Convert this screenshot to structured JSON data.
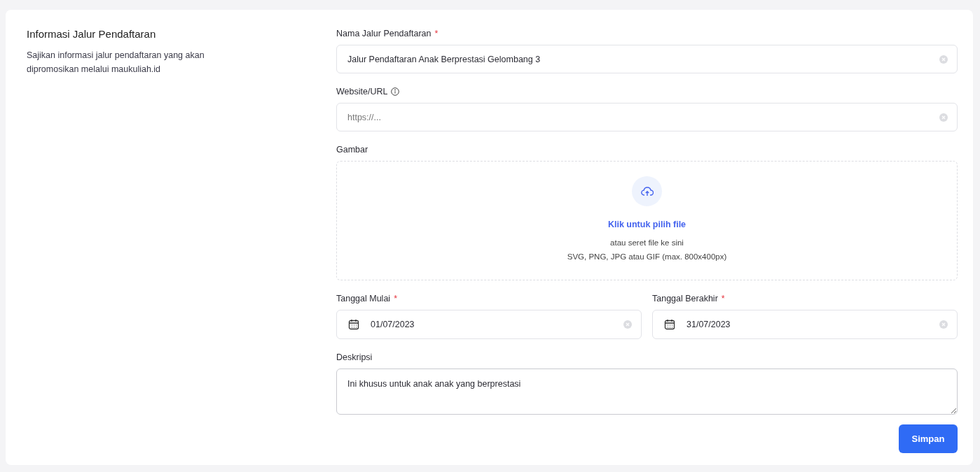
{
  "section": {
    "title": "Informasi Jalur Pendaftaran",
    "description": "Sajikan informasi jalur pendaftaran yang akan dipromosikan melalui maukuliah.id"
  },
  "fields": [
    {
      "kind": "text",
      "label": "Nama Jalur Pendaftaran",
      "required_mark": "*",
      "value": "Jalur Pendaftaran Anak Berprestasi Gelombang 3"
    },
    {
      "kind": "text",
      "label": "Website/URL",
      "info": true,
      "placeholder": "https://..."
    },
    {
      "kind": "upload",
      "label": "Gambar",
      "link": "Klik untuk pilih file",
      "hint": "atau seret file ke sini",
      "formats": "SVG, PNG, JPG atau GIF (max. 800x400px)"
    },
    {
      "kind": "dates",
      "items": [
        {
          "label": "Tanggal Mulai",
          "required_mark": "*",
          "value": "01/07/2023"
        },
        {
          "label": "Tanggal Berakhir",
          "required_mark": "*",
          "value": "31/07/2023"
        }
      ]
    },
    {
      "kind": "textarea",
      "label": "Deskripsi",
      "value": "Ini khusus untuk anak anak yang berprestasi"
    }
  ],
  "submit": "Simpan"
}
